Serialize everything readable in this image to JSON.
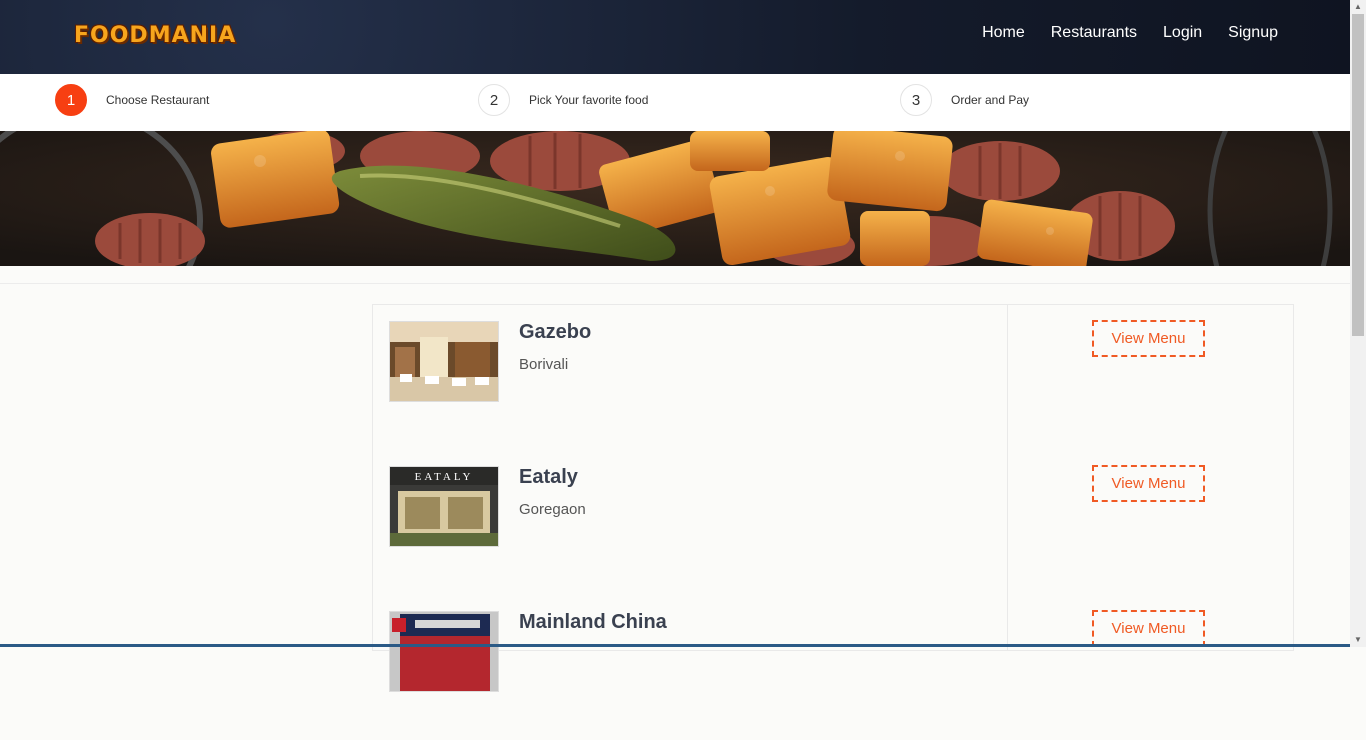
{
  "brand": {
    "logo_text": "FOODMANIA",
    "accent": "#f73f12",
    "button_color": "#f05a24"
  },
  "nav": {
    "items": [
      "Home",
      "Restaurants",
      "Login",
      "Signup"
    ]
  },
  "steps": [
    {
      "num": "1",
      "label": "Choose Restaurant",
      "active": true
    },
    {
      "num": "2",
      "label": "Pick Your favorite food",
      "active": false
    },
    {
      "num": "3",
      "label": "Order and Pay",
      "active": false
    }
  ],
  "restaurants": [
    {
      "name": "Gazebo",
      "location": "Borivali",
      "button": "View Menu"
    },
    {
      "name": "Eataly",
      "location": "Goregaon",
      "button": "View Menu",
      "sign": "EATALY"
    },
    {
      "name": "Mainland China",
      "location": "",
      "button": "View Menu"
    }
  ],
  "scrollbar": {
    "icons": [
      "scroll-up-arrow-icon",
      "scroll-down-arrow-icon"
    ]
  }
}
